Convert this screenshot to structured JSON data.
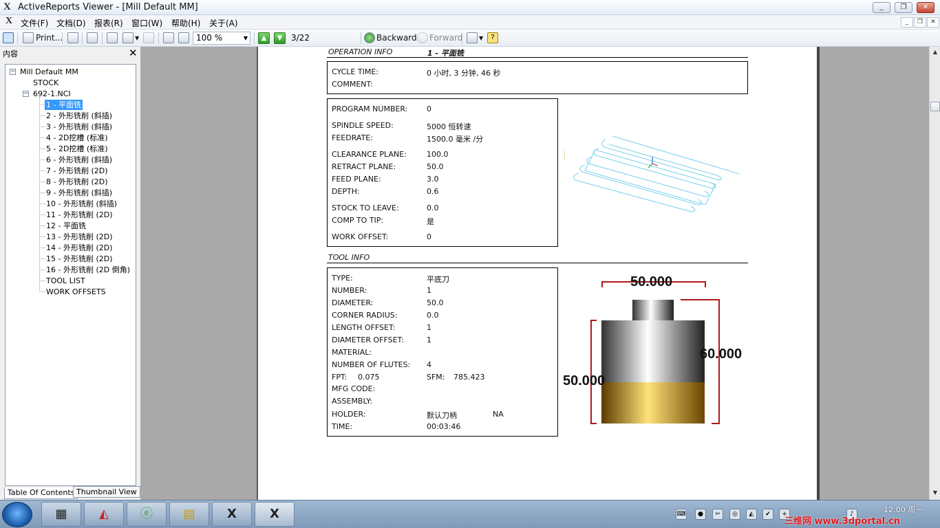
{
  "window": {
    "title": "ActiveReports Viewer - [Mill Default MM]",
    "minimize": "_",
    "restore": "❐",
    "close": "✕"
  },
  "menu": {
    "items": [
      "文件(F)",
      "文档(D)",
      "报表(R)",
      "窗口(W)",
      "帮助(H)",
      "关于(A)"
    ]
  },
  "toolbar": {
    "print_label": "Print...",
    "zoom": "100 %",
    "page": "3/22",
    "backward_label": "Backward",
    "forward_label": "Forward"
  },
  "panel": {
    "title": "内容",
    "close": "✕",
    "tree": {
      "root": "Mill Default MM",
      "stock": "STOCK",
      "nci": "692-1.NCI",
      "ops": [
        "1 - 平面铣",
        "2 - 外形铣削 (斜插)",
        "3 - 外形铣削 (斜插)",
        "4 - 2D挖槽 (标准)",
        "5 - 2D挖槽 (标准)",
        "6 - 外形铣削 (斜插)",
        "7 - 外形铣削 (2D)",
        "8 - 外形铣削 (2D)",
        "9 - 外形铣削 (斜插)",
        "10 - 外形铣削 (斜插)",
        "11 - 外形铣削 (2D)",
        "12 - 平面铣",
        "13 - 外形铣削 (2D)",
        "14 - 外形铣削 (2D)",
        "15 - 外形铣削 (2D)",
        "16 - 外形铣削 (2D 倒角)",
        "TOOL LIST",
        "WORK OFFSETS"
      ]
    },
    "tabs": [
      "Table Of Contents",
      "Thumbnail View"
    ]
  },
  "report": {
    "op_section": "OPERATION INFO",
    "op_name": "1 - 平面铣",
    "cycle_time_label": "CYCLE TIME:",
    "cycle_time": "0 小时, 3 分钟, 46 秒",
    "comment_label": "COMMENT:",
    "params": [
      {
        "label": "PROGRAM NUMBER:",
        "value": "0"
      },
      {
        "label": "SPINDLE SPEED:",
        "value": "5000 恒转速"
      },
      {
        "label": "FEEDRATE:",
        "value": "1500.0 毫米  /分"
      },
      {
        "label": "CLEARANCE PLANE:",
        "value": "100.0"
      },
      {
        "label": "RETRACT PLANE:",
        "value": "50.0"
      },
      {
        "label": "FEED PLANE:",
        "value": "3.0"
      },
      {
        "label": "DEPTH:",
        "value": "0.6"
      },
      {
        "label": "STOCK TO LEAVE:",
        "value": "0.0"
      },
      {
        "label": "COMP TO TIP:",
        "value": "是"
      },
      {
        "label": "WORK OFFSET:",
        "value": "0"
      }
    ],
    "tool_section": "TOOL INFO",
    "tool": [
      {
        "label": "TYPE:",
        "value": "平底刀"
      },
      {
        "label": "NUMBER:",
        "value": "1"
      },
      {
        "label": "DIAMETER:",
        "value": "50.0"
      },
      {
        "label": "CORNER RADIUS:",
        "value": "0.0"
      },
      {
        "label": "LENGTH OFFSET:",
        "value": "1"
      },
      {
        "label": "DIAMETER OFFSET:",
        "value": "1"
      },
      {
        "label": "MATERIAL:",
        "value": ""
      },
      {
        "label": "NUMBER OF FLUTES:",
        "value": "4"
      }
    ],
    "fpt_label": "FPT:",
    "fpt": "0.075",
    "sfm_label": "SFM:",
    "sfm": "785.423",
    "mfg_label": "MFG CODE:",
    "assembly_label": "ASSEMBLY:",
    "holder_label": "HOLDER:",
    "holder": "默认刀柄",
    "holder_extra": "NA",
    "time_label": "TIME:",
    "time": "00:03:46",
    "dim_top": "50.000",
    "dim_right": "60.000",
    "dim_left": "50.000"
  },
  "taskbar": {
    "clock_time": "12:00",
    "clock_day": "周一",
    "watermark": "三维网 www.3dportal.cn"
  }
}
